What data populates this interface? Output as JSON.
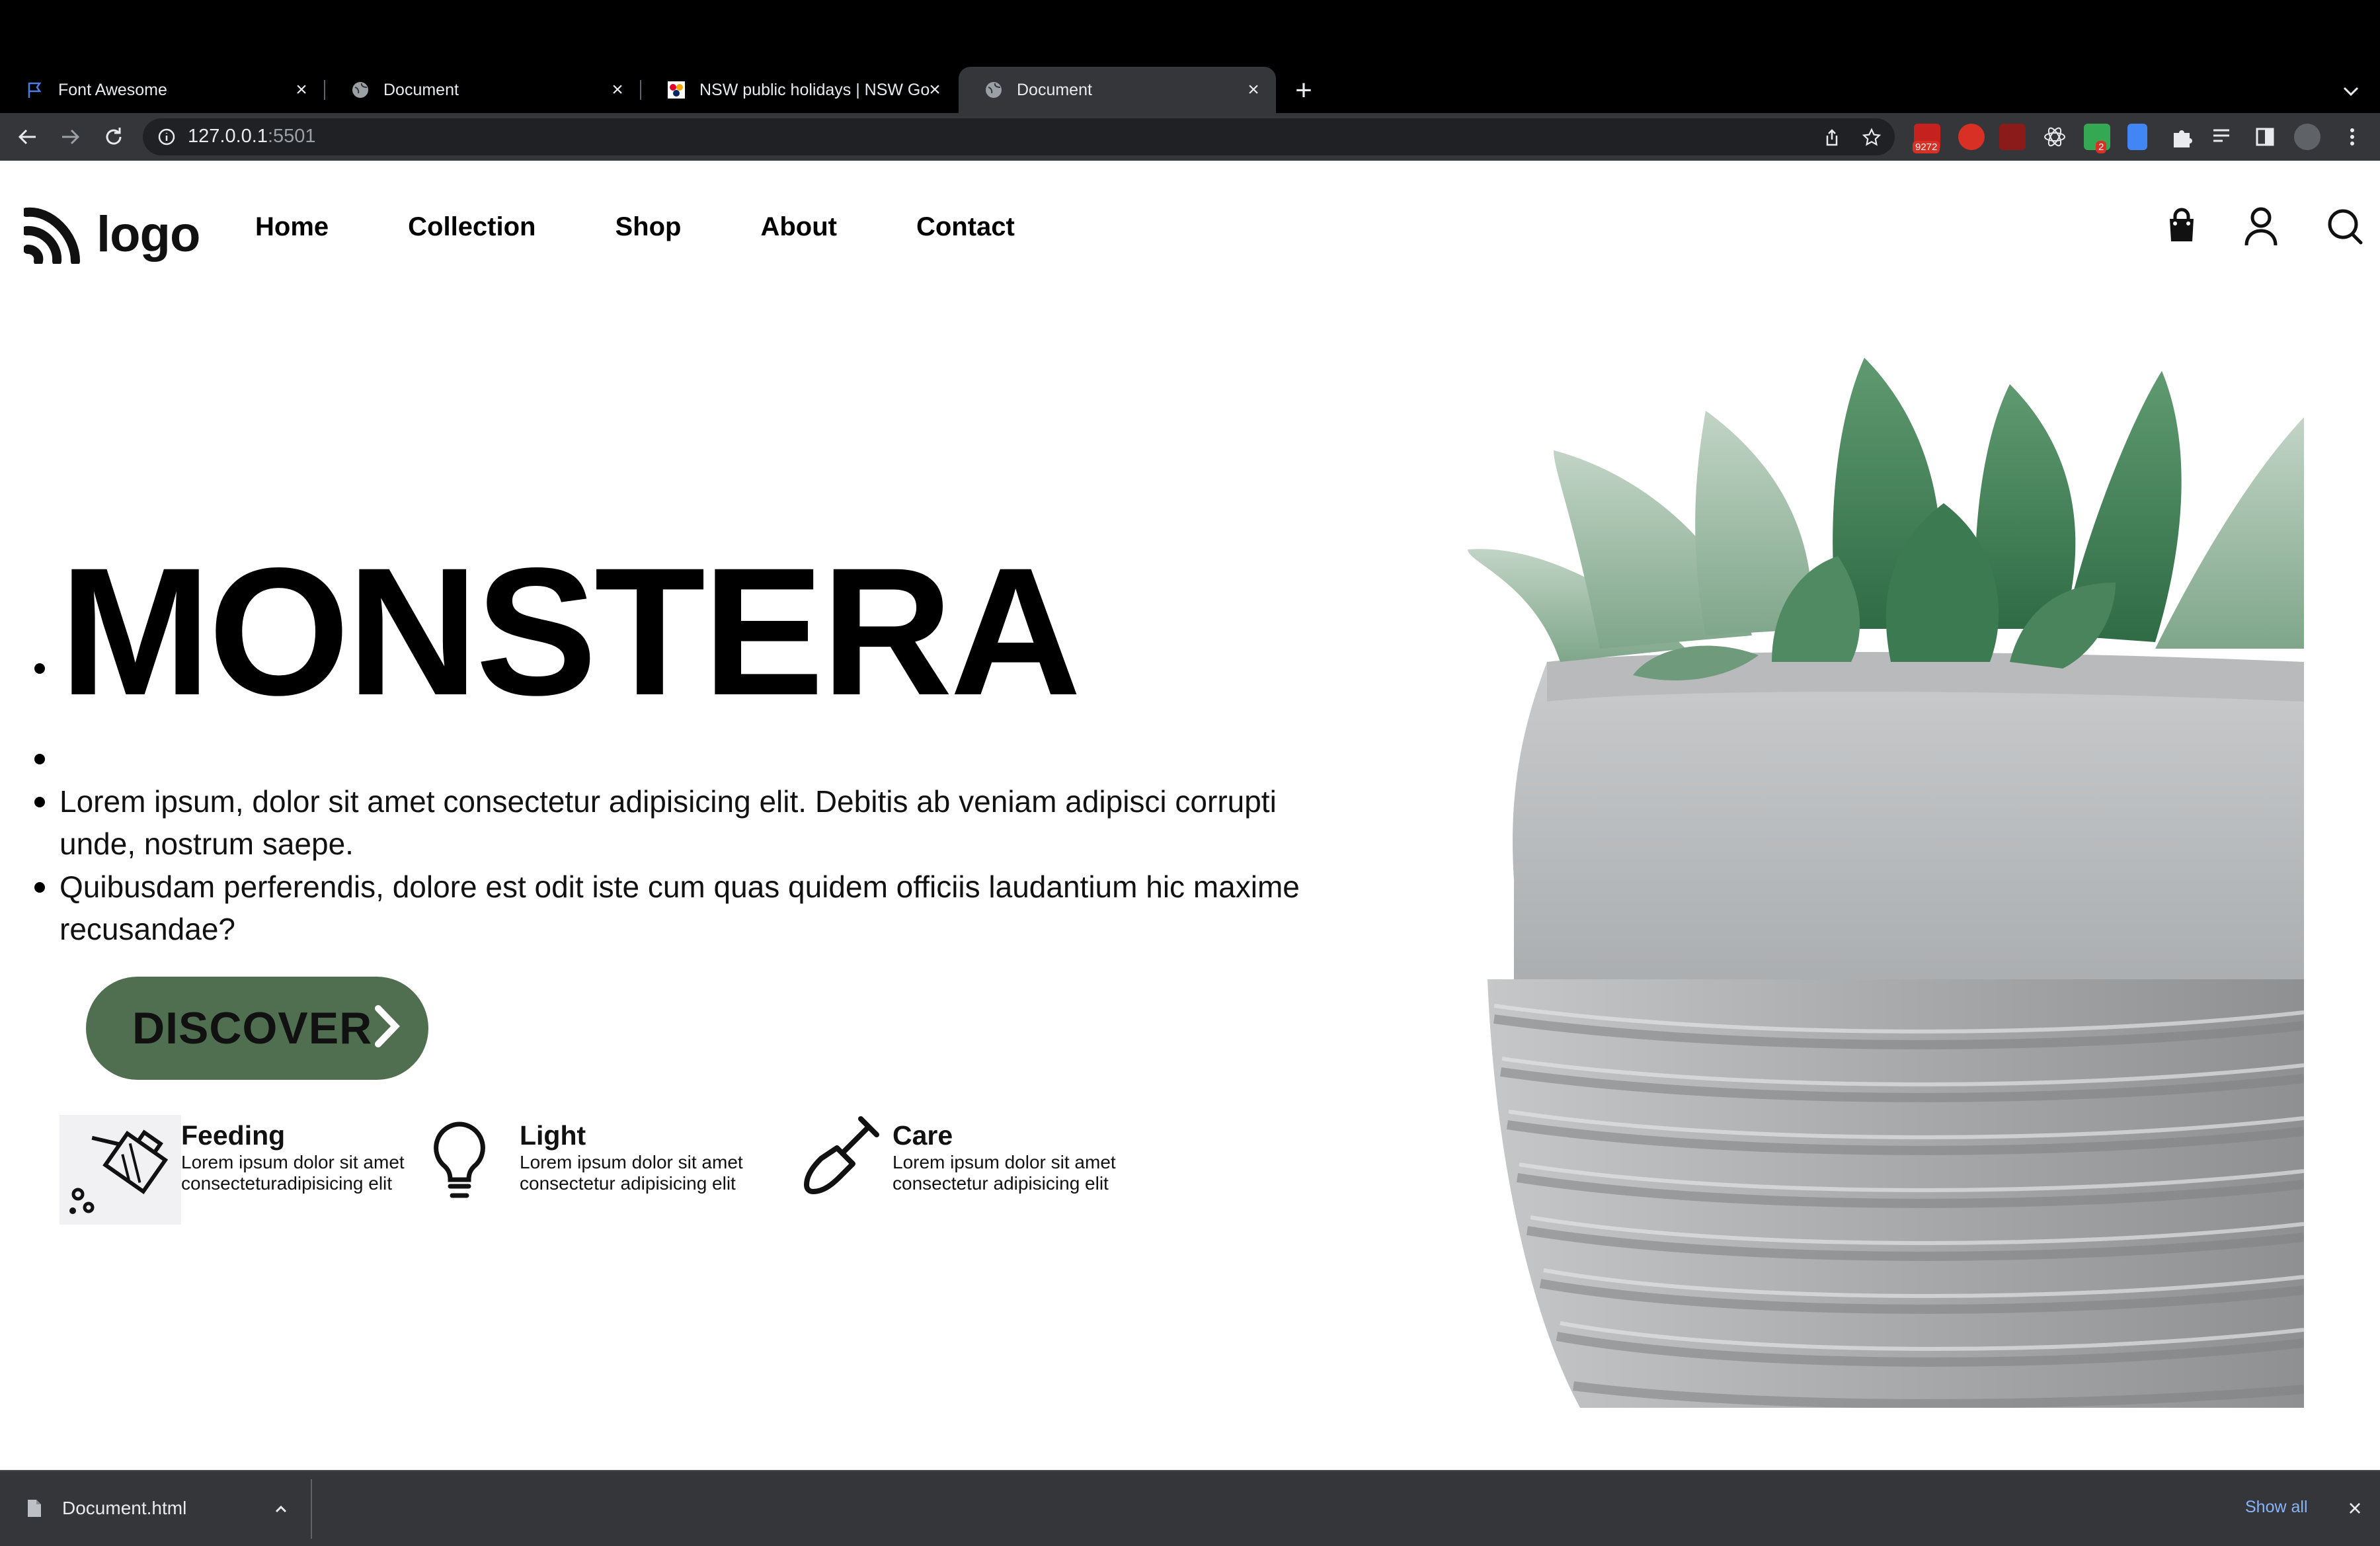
{
  "browser": {
    "tabs": [
      {
        "title": "Font Awesome",
        "icon": "flag-icon",
        "active": false
      },
      {
        "title": "Document",
        "icon": "globe-icon",
        "active": false
      },
      {
        "title": "NSW public holidays | NSW Go",
        "icon": "nsw-gov-icon",
        "active": false
      },
      {
        "title": "Document",
        "icon": "globe-icon",
        "active": true
      }
    ],
    "url_host": "127.0.0.1",
    "url_port": ":5501",
    "extension_badges": [
      "9272",
      "2"
    ]
  },
  "page": {
    "logo_text": "logo",
    "nav": [
      "Home",
      "Collection",
      "Shop",
      "About",
      "Contact"
    ],
    "hero": {
      "title": "MONSTERA",
      "paragraph1": "Lorem ipsum, dolor sit amet consectetur adipisicing elit. Debitis ab veniam adipisci corrupti unde, nostrum saepe.",
      "paragraph2": "Quibusdam perferendis, dolore est odit iste cum quas quidem officiis laudantium hic maxime recusandae?",
      "button_label": "DISCOVER"
    },
    "features": [
      {
        "title": "Feeding",
        "text": "Lorem ipsum dolor sit amet consecteturadipisicing elit",
        "icon": "watering-can-icon"
      },
      {
        "title": "Light",
        "text": "Lorem ipsum dolor sit amet consectetur adipisicing elit",
        "icon": "lightbulb-icon"
      },
      {
        "title": "Care",
        "text": "Lorem ipsum dolor sit amet consectetur adipisicing elit",
        "icon": "shovel-icon"
      }
    ],
    "accent_color": "#506f50"
  },
  "downloads": {
    "file_name": "Document.html",
    "show_all": "Show all"
  }
}
